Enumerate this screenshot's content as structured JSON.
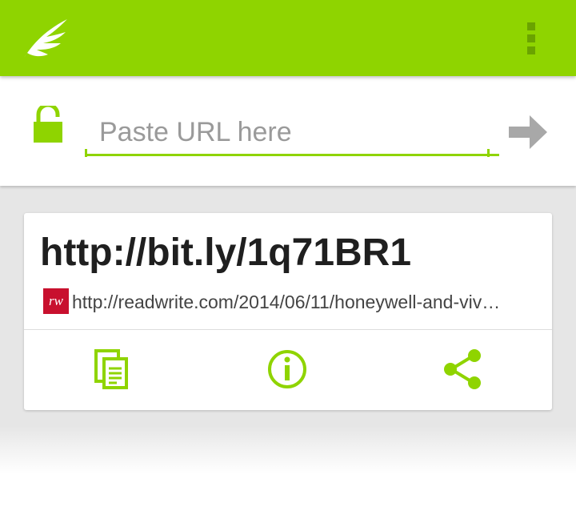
{
  "app": {
    "logo_icon": "wing-icon",
    "overflow_icon": "overflow-menu-icon",
    "accent_color": "#8fd400"
  },
  "url_bar": {
    "lock_icon": "unlocked-padlock-icon",
    "placeholder": "Paste URL here",
    "value": "",
    "go_icon": "arrow-right-icon"
  },
  "result": {
    "short_url": "http://bit.ly/1q71BR1",
    "favicon_text": "rw",
    "favicon_color": "#c8102e",
    "long_url": "http://readwrite.com/2014/06/11/honeywell-and-viv…",
    "actions": {
      "copy_icon": "copy-icon",
      "info_icon": "info-icon",
      "share_icon": "share-icon"
    }
  }
}
